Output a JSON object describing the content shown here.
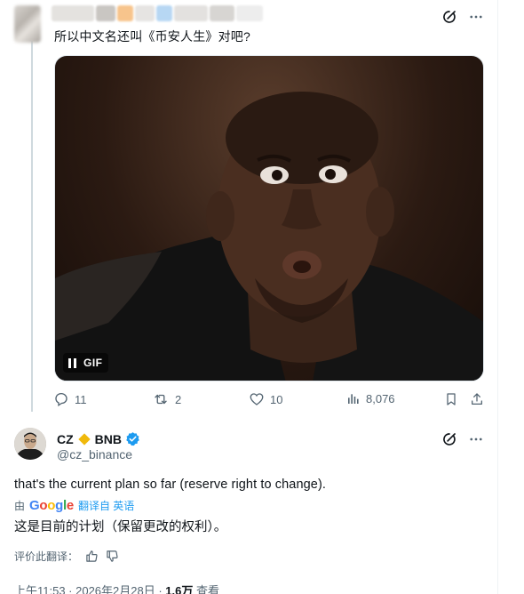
{
  "post1": {
    "text": "所以中文名还叫《币安人生》对吧?",
    "media": {
      "badge": "GIF"
    },
    "actions": {
      "replies": "11",
      "reposts": "2",
      "likes": "10",
      "views": "8,076"
    }
  },
  "post2": {
    "display_name": "CZ",
    "name_suffix": "BNB",
    "handle": "@cz_binance",
    "text": "that's the current plan so far (reserve right to change).",
    "translated_by_prefix": "由",
    "translated_by_brand": "Google",
    "translated_from": "翻译自 英语",
    "translation": "这是目前的计划（保留更改的权利）。",
    "rate_label": "评价此翻译：",
    "time": "上午11:53 · 2026年2月28日 · ",
    "views_count": "1.6万",
    "views_label": " 查看"
  },
  "colors": {
    "accent": "#1d9bf0",
    "muted": "#536471",
    "verified": "#1d9bf0",
    "bnb": "#f0b90b"
  }
}
